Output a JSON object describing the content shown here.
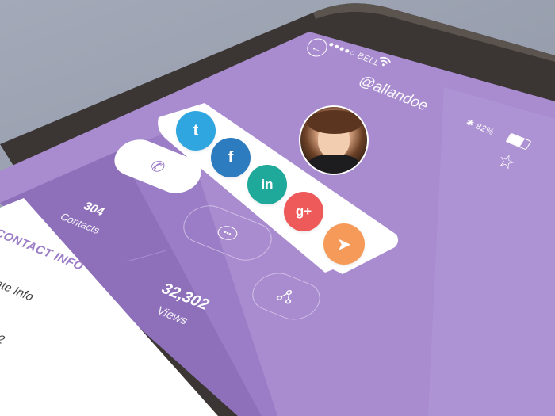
{
  "status_bar": {
    "carrier": "BELL",
    "battery_percent": "82%"
  },
  "profile": {
    "handle": "@allandoe"
  },
  "stats": {
    "contacts_count": "304",
    "contacts_label": "Contacts",
    "views_count": "32,302",
    "views_label": "Views"
  },
  "contact_panel": {
    "title": "CONTACT INFO",
    "line1": "ate Info",
    "line2": "2"
  },
  "share_popup": {
    "items": [
      {
        "name": "twitter",
        "glyph": "t",
        "color": "#2fa6e0"
      },
      {
        "name": "facebook",
        "glyph": "f",
        "color": "#2e7cc0"
      },
      {
        "name": "linkedin",
        "glyph": "in",
        "color": "#1fa99a"
      },
      {
        "name": "google-plus",
        "glyph": "g+",
        "color": "#ee5a5a"
      },
      {
        "name": "send",
        "glyph": "➤",
        "color": "#f59a58"
      }
    ]
  },
  "colors": {
    "screen_purple": "#a98bd0",
    "screen_dark": "#8d6fba",
    "accent_orange": "#f59a58"
  }
}
